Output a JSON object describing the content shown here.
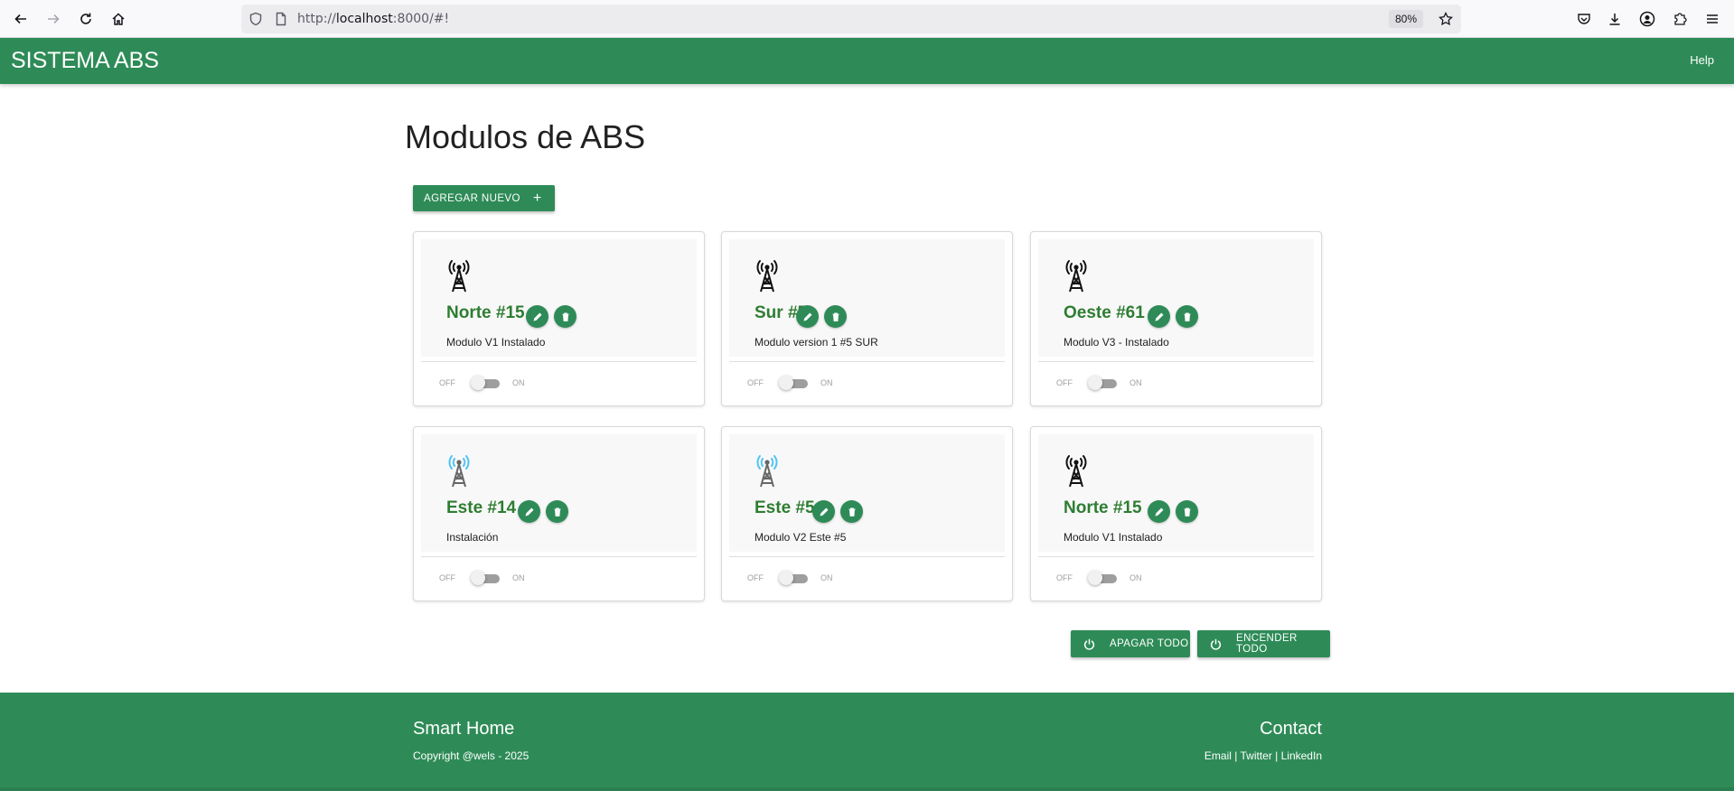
{
  "browser": {
    "url_prefix": "http://",
    "url_host": "localhost",
    "url_rest": ":8000/#!",
    "zoom": "80%",
    "icons": [
      "back-icon",
      "forward-icon",
      "reload-icon",
      "home-icon",
      "shield-icon",
      "page-icon",
      "star-icon",
      "pocket-icon",
      "download-icon",
      "account-icon",
      "extensions-icon",
      "menu-icon"
    ]
  },
  "header": {
    "brand": "SISTEMA ABS",
    "help": "Help"
  },
  "main": {
    "title": "Modulos de ABS",
    "add_button": "AGREGAR NUEVO",
    "add_icon": "+",
    "cards": [
      {
        "title": "Norte #15",
        "description": "Modulo V1 Instalado",
        "off": "OFF",
        "on": "ON",
        "icon": "tower-icon",
        "icon_variant": "black",
        "switch_on": false
      },
      {
        "title": "Sur #5",
        "description": "Modulo version 1 #5 SUR",
        "off": "OFF",
        "on": "ON",
        "icon": "tower-icon",
        "icon_variant": "black",
        "switch_on": false
      },
      {
        "title": "Oeste #61",
        "description": "Modulo V3 - Instalado",
        "off": "OFF",
        "on": "ON",
        "icon": "tower-icon",
        "icon_variant": "black",
        "switch_on": false
      },
      {
        "title": "Este #14",
        "description": "Instalación",
        "off": "OFF",
        "on": "ON",
        "icon": "tower-icon",
        "icon_variant": "blue",
        "switch_on": false
      },
      {
        "title": "Este #5",
        "description": "Modulo V2 Este #5",
        "off": "OFF",
        "on": "ON",
        "icon": "tower-icon",
        "icon_variant": "blue",
        "switch_on": false
      },
      {
        "title": "Norte #15",
        "description": "Modulo V1 Instalado",
        "off": "OFF",
        "on": "ON",
        "icon": "tower-icon",
        "icon_variant": "black",
        "switch_on": false
      }
    ],
    "apagar_button": "APAGAR TODO",
    "encender_button": "ENCENDER TODO"
  },
  "footer": {
    "left_title": "Smart Home",
    "copyright": "Copyright @wels - 2025",
    "right_title": "Contact",
    "links": "Email | Twitter | LinkedIn"
  },
  "colors": {
    "primary": "#2e8b57",
    "title_green": "#2e7d32",
    "wave_blue": "#4fc3f7"
  }
}
